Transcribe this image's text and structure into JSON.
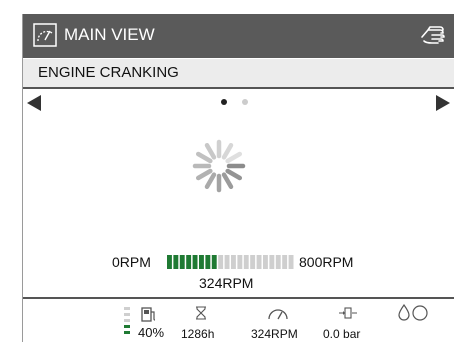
{
  "header": {
    "title": "MAIN VIEW",
    "view_icon": "main-view-icon",
    "hand_icon": "hand-icon"
  },
  "status": {
    "text": "ENGINE CRANKING"
  },
  "pager": {
    "pages": 2,
    "active": 0,
    "left_icon": "left-arrow-icon",
    "right_icon": "right-arrow-icon"
  },
  "spinner_icon": "loading-spinner-icon",
  "rpm": {
    "min_label": "0RPM",
    "max_label": "800RPM",
    "value_label": "324RPM",
    "fraction": 0.405,
    "segments": 20
  },
  "info": {
    "fuel_percent": "40%",
    "engine_hours": "1286h",
    "engine_speed": "324RPM",
    "oil_pressure": "0.0 bar",
    "fuel_icon": "fuel-pump-icon",
    "hours_icon": "hourglass-icon",
    "speed_icon": "gauge-icon",
    "pressure_icon": "oil-pressure-icon",
    "coolant_icon": "water-drop-icon"
  },
  "colors": {
    "header_bg": "#5a5a5a",
    "bar_on": "#1f7a33",
    "bar_off": "#cfcfcf",
    "accent": "#ffffff"
  }
}
